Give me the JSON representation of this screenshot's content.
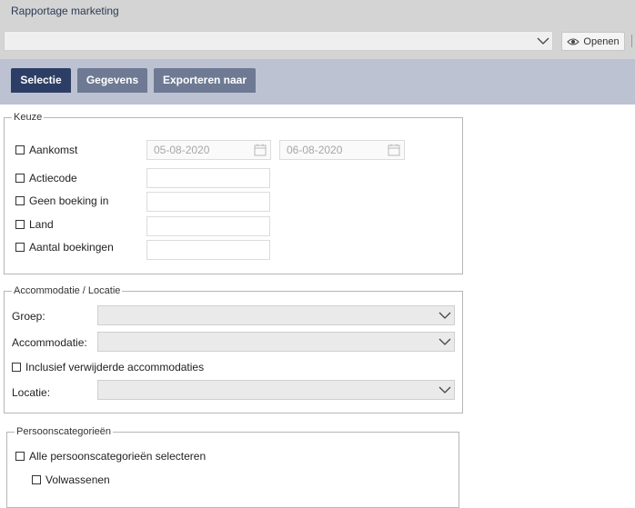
{
  "app": {
    "title": "Rapportage marketing"
  },
  "toolbar": {
    "selected_value": "",
    "open_label": "Openen"
  },
  "tabs": [
    {
      "label": "Selectie",
      "active": true
    },
    {
      "label": "Gegevens",
      "active": false
    },
    {
      "label": "Exporteren naar",
      "active": false
    }
  ],
  "keuze": {
    "legend": "Keuze",
    "rows": [
      {
        "label": "Aankomst",
        "checked": false,
        "from_date": "05-08-2020",
        "to_date": "06-08-2020"
      },
      {
        "label": "Actiecode",
        "checked": false,
        "value": ""
      },
      {
        "label": "Geen boeking in",
        "checked": false,
        "value": ""
      },
      {
        "label": "Land",
        "checked": false,
        "value": ""
      },
      {
        "label": "Aantal boekingen",
        "checked": false,
        "value": ""
      }
    ]
  },
  "accommodatie": {
    "legend": "Accommodatie / Locatie",
    "groep_label": "Groep:",
    "accommodatie_label": "Accommodatie:",
    "inclusief_label": "Inclusief verwijderde accommodaties",
    "locatie_label": "Locatie:"
  },
  "persoon": {
    "legend": "Persoonscategorieën",
    "all_label": "Alle persoonscategorieën selecteren",
    "volwassenen_label": "Volwassenen"
  },
  "colors": {
    "accent": "#2d3e66",
    "tab_inactive": "#6e7a93",
    "tabbar": "#bcc2d1",
    "header": "#d4d4d4"
  }
}
